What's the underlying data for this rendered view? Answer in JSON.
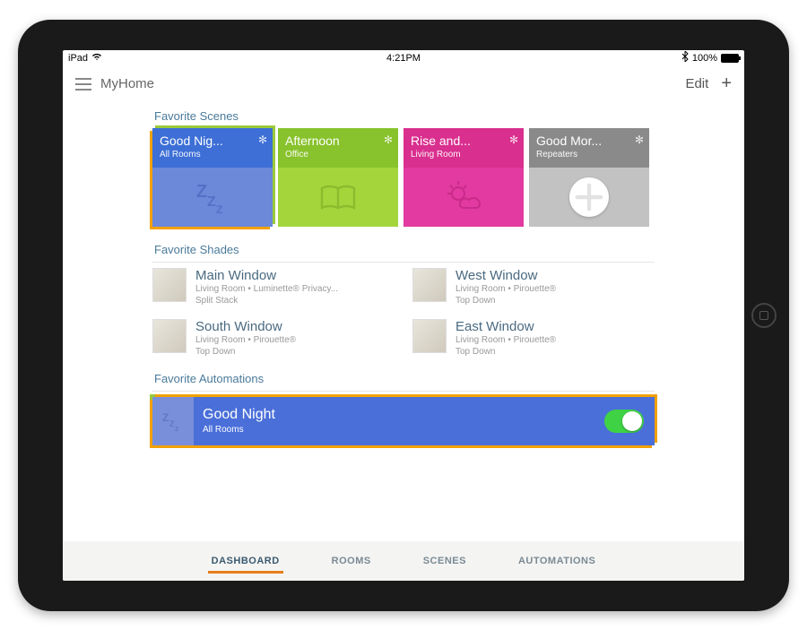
{
  "status": {
    "device": "iPad",
    "time": "4:21PM",
    "battery": "100%"
  },
  "header": {
    "title": "MyHome",
    "edit": "Edit"
  },
  "sections": {
    "scenes_title": "Favorite Scenes",
    "shades_title": "Favorite Shades",
    "automations_title": "Favorite Automations"
  },
  "scenes": [
    {
      "name": "Good Nig...",
      "room": "All Rooms",
      "icon": "sleep"
    },
    {
      "name": "Afternoon",
      "room": "Office",
      "icon": "book"
    },
    {
      "name": "Rise and...",
      "room": "Living Room",
      "icon": "sun-cloud"
    },
    {
      "name": "Good Mor...",
      "room": "Repeaters",
      "icon": "plus-circle"
    }
  ],
  "shades": [
    {
      "name": "Main Window",
      "line1": "Living Room • Luminette® Privacy...",
      "line2": "Split Stack"
    },
    {
      "name": "West Window",
      "line1": "Living Room • Pirouette®",
      "line2": "Top Down"
    },
    {
      "name": "South Window",
      "line1": "Living Room • Pirouette®",
      "line2": "Top Down"
    },
    {
      "name": "East Window",
      "line1": "Living Room • Pirouette®",
      "line2": "Top Down"
    }
  ],
  "automation": {
    "name": "Good Night",
    "room": "All Rooms",
    "enabled": true
  },
  "tabs": {
    "dashboard": "DASHBOARD",
    "rooms": "ROOMS",
    "scenes": "SCENES",
    "automations": "AUTOMATIONS"
  }
}
